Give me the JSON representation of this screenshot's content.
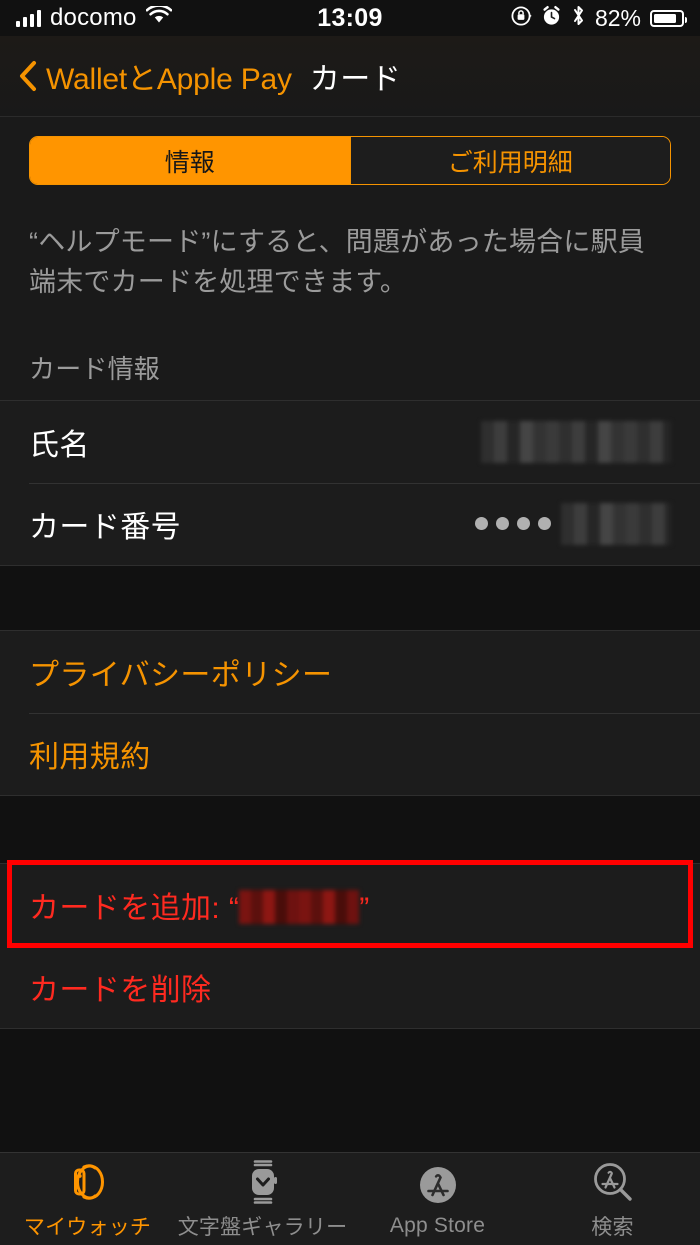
{
  "status_bar": {
    "carrier": "docomo",
    "signal_icon": "signal-bars-icon",
    "wifi_icon": "wifi-icon",
    "time": "13:09",
    "rotation_lock_icon": "rotation-lock-icon",
    "alarm_icon": "alarm-clock-icon",
    "bluetooth_icon": "bluetooth-icon",
    "battery_percent": "82%",
    "battery_icon": "battery-full-icon"
  },
  "nav_bar": {
    "back_icon": "chevron-left-icon",
    "back_label": "WalletとApple Pay",
    "title": "カード"
  },
  "segmented_control": {
    "selected_index": 0,
    "segments": [
      {
        "label": "情報"
      },
      {
        "label": "ご利用明細"
      }
    ]
  },
  "description": "“ヘルプモード”にすると、問題があった場合に駅員端末でカードを処理できます。",
  "sections": [
    {
      "header": "カード情報",
      "rows": [
        {
          "label": "氏名",
          "value_type": "redacted",
          "value": ""
        },
        {
          "label": "カード番号",
          "value_type": "dots-redacted",
          "dots": 4,
          "value": ""
        }
      ]
    },
    {
      "header": "",
      "rows": [
        {
          "label": "プライバシーポリシー",
          "style": "link"
        },
        {
          "label": "利用規約",
          "style": "link"
        }
      ]
    },
    {
      "header": "",
      "rows": [
        {
          "label_prefix": "カードを追加: “",
          "label_suffix": "”",
          "style": "danger",
          "annotated": true
        },
        {
          "label": "カードを削除",
          "style": "danger"
        }
      ]
    }
  ],
  "annotation": {
    "color": "#FF0000",
    "target": "カードを追加"
  },
  "tab_bar": {
    "selected_index": 0,
    "tabs": [
      {
        "label": "マイウォッチ",
        "icon": "watch-side-icon"
      },
      {
        "label": "文字盤ギャラリー",
        "icon": "watch-face-icon"
      },
      {
        "label": "App Store",
        "icon": "app-store-icon"
      },
      {
        "label": "検索",
        "icon": "app-store-search-icon"
      }
    ]
  },
  "colors": {
    "accent_orange": "#FF9500",
    "link_orange": "#f59300",
    "danger_red": "#ff2a20",
    "annotation_red": "#FF0000",
    "background": "#1a1a1a",
    "row_background": "#1c1c1c",
    "secondary_text": "#9b9b9b"
  }
}
